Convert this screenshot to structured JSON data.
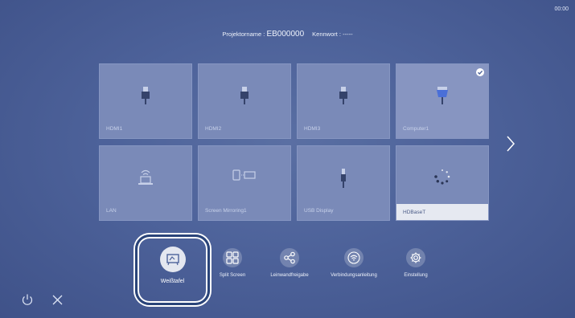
{
  "clock": "00:00",
  "header": {
    "projector_label": "Projektorname : ",
    "projector_value": "EB000000",
    "password_label": "Kennwort : ",
    "password_value": "-----"
  },
  "sources": [
    {
      "label": "HDMI1",
      "icon": "hdmi-plug-icon"
    },
    {
      "label": "HDMI2",
      "icon": "hdmi-plug-icon"
    },
    {
      "label": "HDMI3",
      "icon": "hdmi-plug-icon"
    },
    {
      "label": "Computer1",
      "icon": "vga-plug-icon",
      "selected": true
    },
    {
      "label": "LAN",
      "icon": "lan-computer-icon"
    },
    {
      "label": "Screen Mirroring1",
      "icon": "screen-mirroring-icon"
    },
    {
      "label": "USB Display",
      "icon": "usb-plug-icon"
    },
    {
      "label": "HDBaseT",
      "icon": "loading-spinner-icon",
      "active": true
    }
  ],
  "actions": {
    "whiteboard": "Weißtafel",
    "split_screen": "Split Screen",
    "screen_share": "Leinwandfreigabe",
    "connection_guide": "Verbindungsanleitung",
    "settings": "Einstellung"
  },
  "colors": {
    "background": "#4d629a",
    "tile": "#7a8ab8",
    "focus_ring": "#2a4479",
    "accent_plug": "#4a6fd8"
  }
}
